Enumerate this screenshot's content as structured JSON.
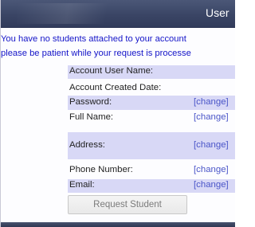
{
  "header": {
    "title": "User"
  },
  "notice": {
    "line1": "You have no students attached to your account",
    "line2": "please be patient while your request is processe"
  },
  "account_rows": [
    {
      "label": "Account User Name:",
      "action": ""
    },
    {
      "label": "Account Created Date:",
      "action": ""
    },
    {
      "label": "Password:",
      "action": "[change]"
    },
    {
      "label": "Full Name:",
      "action": "[change]"
    },
    {
      "label": "Address:",
      "action": "[change]"
    },
    {
      "label": "Phone Number:",
      "action": "[change]"
    },
    {
      "label": "Email:",
      "action": "[change]"
    }
  ],
  "button": {
    "label": "Request Student"
  },
  "colors": {
    "header": "#3a4565",
    "notice_text": "#1414c8",
    "row_alt": "#d8d8f6",
    "link": "#4a55c8"
  }
}
